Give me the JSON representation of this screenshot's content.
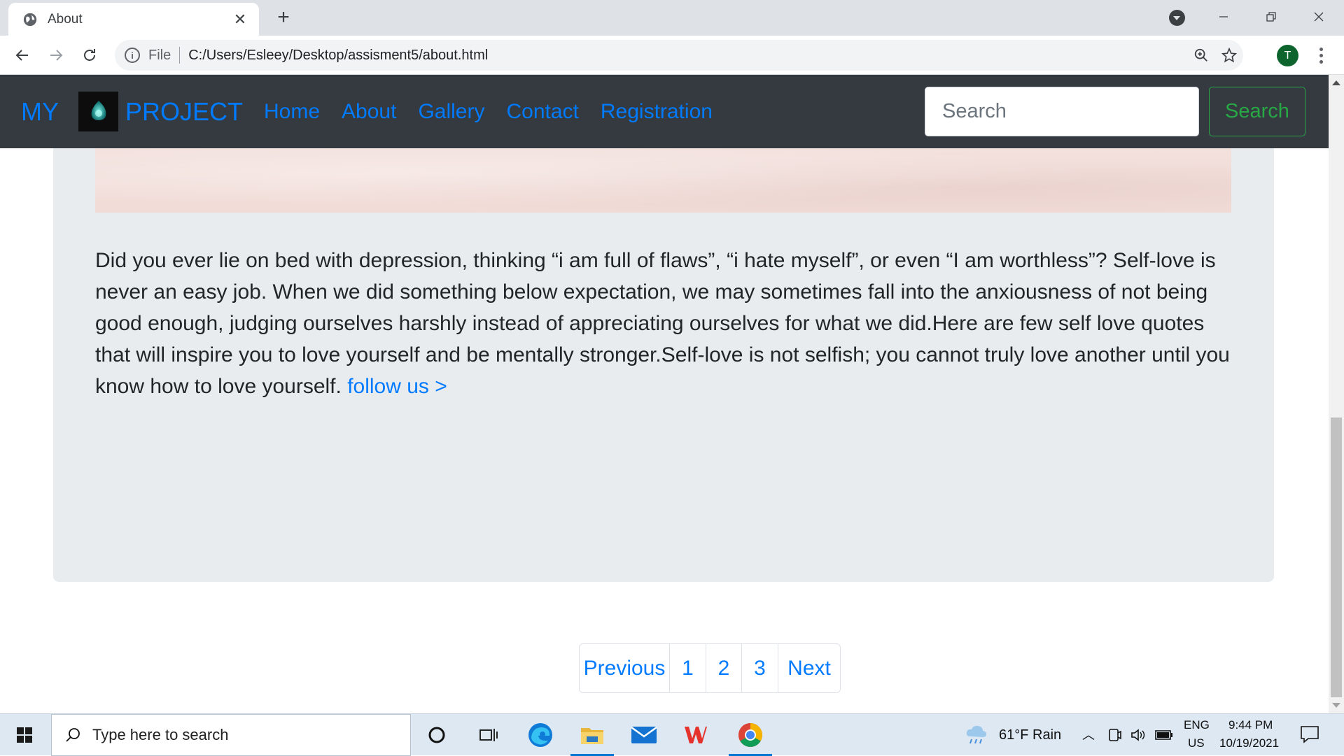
{
  "browser": {
    "tab_title": "About",
    "url_scheme": "File",
    "url": "C:/Users/Esleey/Desktop/assisment5/about.html",
    "profile_initial": "T"
  },
  "navbar": {
    "brand_left": "MY",
    "brand_right": "PROJECT",
    "links": [
      "Home",
      "About",
      "Gallery",
      "Contact",
      "Registration"
    ],
    "search_placeholder": "Search",
    "search_button": "Search"
  },
  "article": {
    "text": "Did you ever lie on bed with depression, thinking “i am full of flaws”, “i hate myself”, or even “I am worthless”? Self-love is never an easy job. When we did something below expectation, we may sometimes fall into the anxiousness of not being good enough, judging ourselves harshly instead of appreciating ourselves for what we did.Here are few self love quotes that will inspire you to love yourself and be mentally stronger.Self-love is not selfish; you cannot truly love another until you know how to love yourself.",
    "link": "follow us >"
  },
  "pagination": {
    "previous": "Previous",
    "pages": [
      "1",
      "2",
      "3"
    ],
    "next": "Next"
  },
  "taskbar": {
    "search_placeholder": "Type here to search",
    "weather": "61°F  Rain",
    "lang_top": "ENG",
    "lang_bottom": "US",
    "time": "9:44 PM",
    "date": "10/19/2021"
  },
  "colors": {
    "navbar_bg": "#343a40",
    "link": "#007bff",
    "success": "#28a745",
    "jumbotron_bg": "#e9ecef"
  }
}
